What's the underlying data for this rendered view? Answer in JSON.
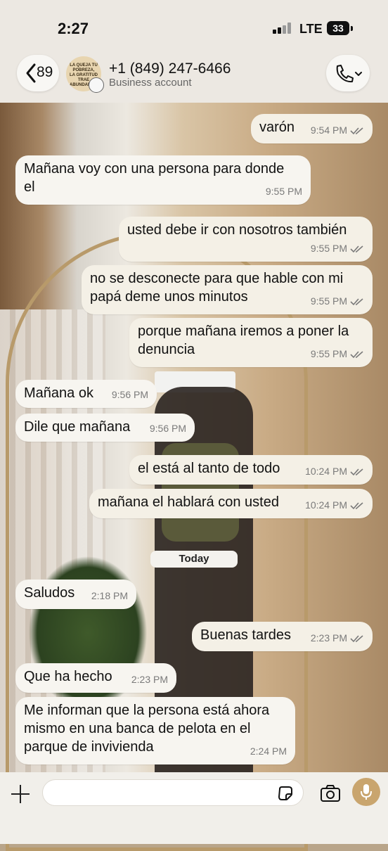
{
  "status_bar": {
    "time": "2:27",
    "network": "LTE",
    "battery": "33"
  },
  "header": {
    "back_count": "89",
    "contact_name": "+1 (849) 247-6466",
    "contact_subtitle": "Business account",
    "avatar_text": "LA QUEJA TU POBREZA, LA GRATITUD TRAE ABUNDANCIA"
  },
  "messages": [
    {
      "text": "varón",
      "time": "9:54 PM",
      "direction": "out",
      "read": true
    },
    {
      "text": "Mañana voy con una persona para donde\nel",
      "time": "9:55 PM",
      "direction": "in"
    },
    {
      "text": "usted debe ir con nosotros también",
      "time": "9:55 PM",
      "direction": "out",
      "read": true
    },
    {
      "text": "no se desconecte para que hable con mi\npapá deme unos minutos",
      "time": "9:55 PM",
      "direction": "out",
      "read": true
    },
    {
      "text": "porque mañana iremos a poner la\ndenuncia",
      "time": "9:55 PM",
      "direction": "out",
      "read": true
    },
    {
      "text": "Mañana ok",
      "time": "9:56 PM",
      "direction": "in"
    },
    {
      "text": "Dile que mañana",
      "time": "9:56 PM",
      "direction": "in"
    },
    {
      "text": "el está al tanto de todo",
      "time": "10:24 PM",
      "direction": "out",
      "read": true
    },
    {
      "text": "mañana el hablará con usted",
      "time": "10:24 PM",
      "direction": "out",
      "read": true
    },
    {
      "text": "Saludos",
      "time": "2:18 PM",
      "direction": "in"
    },
    {
      "text": "Buenas tardes",
      "time": "2:23 PM",
      "direction": "out",
      "read": true
    },
    {
      "text": "Que ha hecho",
      "time": "2:23 PM",
      "direction": "in"
    },
    {
      "text": "Me informan que la persona está ahora\nmismo en una banca de pelota en el\nparque de invivienda",
      "time": "2:24 PM",
      "direction": "in"
    }
  ],
  "date_separator": "Today",
  "input": {
    "placeholder": ""
  },
  "colors": {
    "bubble": "#f7f5f0",
    "tick": "#7a7a7a",
    "mic": "#c9a56e"
  }
}
